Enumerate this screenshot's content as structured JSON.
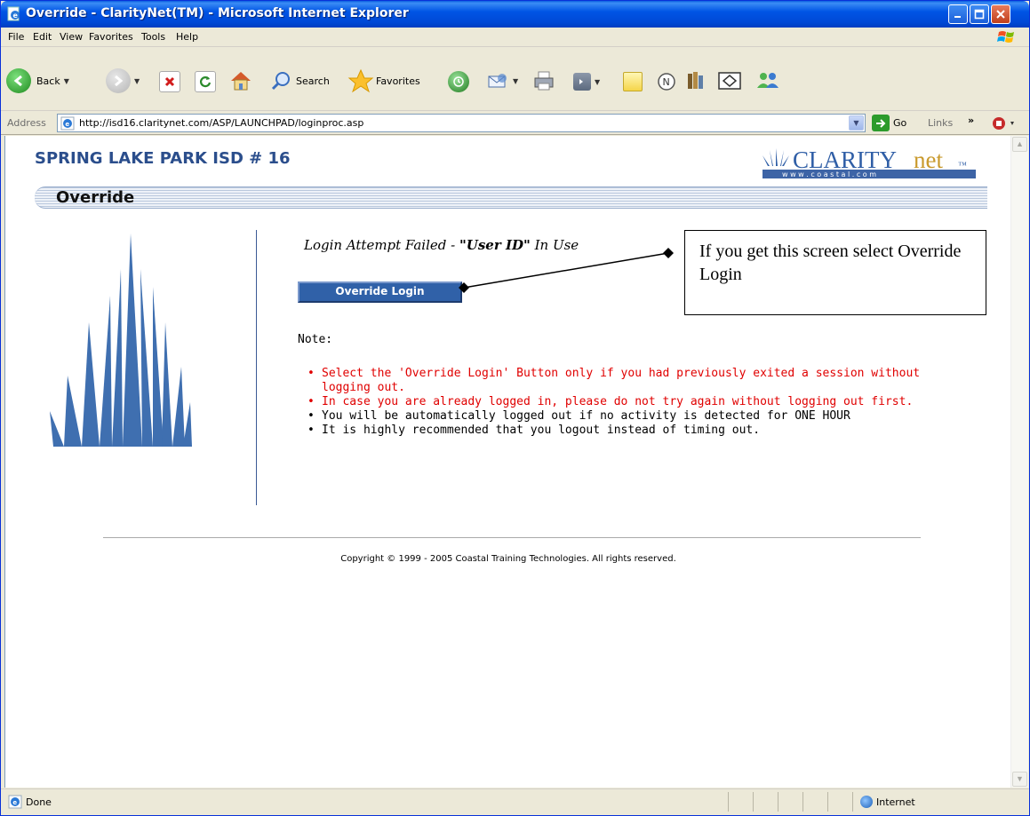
{
  "window": {
    "title": "Override - ClarityNet(TM) - Microsoft Internet Explorer"
  },
  "menu": [
    "File",
    "Edit",
    "View",
    "Favorites",
    "Tools",
    "Help"
  ],
  "toolbar": {
    "back_label": "Back",
    "search_label": "Search",
    "favorites_label": "Favorites"
  },
  "address": {
    "label": "Address",
    "url": "http://isd16.claritynet.com/ASP/LAUNCHPAD/loginproc.asp",
    "go_label": "Go",
    "links_label": "Links",
    "links_more": "»"
  },
  "page": {
    "site_title": "SPRING LAKE PARK ISD # 16",
    "logo_text_clarity": "CLARITY",
    "logo_text_net": "net",
    "logo_tm": "™",
    "logo_url": "w w w . c o a s t a l . c o m",
    "section_title": "Override",
    "failed_prefix": "Login Attempt Failed - ",
    "failed_userid": "\"User ID\"",
    "failed_suffix": " In Use",
    "override_button": "Override Login",
    "note_label": "Note:",
    "notes": [
      {
        "text": "Select the 'Override Login' Button only if you had previously exited a session without logging out.",
        "color": "red"
      },
      {
        "text": "In case you are already logged in, please do not try again without logging out first.",
        "color": "red"
      },
      {
        "text": "You will be automatically logged out if no activity is detected for ONE HOUR",
        "color": "black"
      },
      {
        "text": "It is highly recommended that you logout instead of timing out.",
        "color": "black"
      }
    ],
    "callout": "If you get this screen select Override Login",
    "copyright": "Copyright © 1999 - 2005 Coastal Training Technologies. All rights reserved."
  },
  "status": {
    "text": "Done",
    "zone": "Internet"
  },
  "colors": {
    "title_blue": "#2b4e8c",
    "button_blue": "#3061a8",
    "note_red": "#e00000"
  }
}
